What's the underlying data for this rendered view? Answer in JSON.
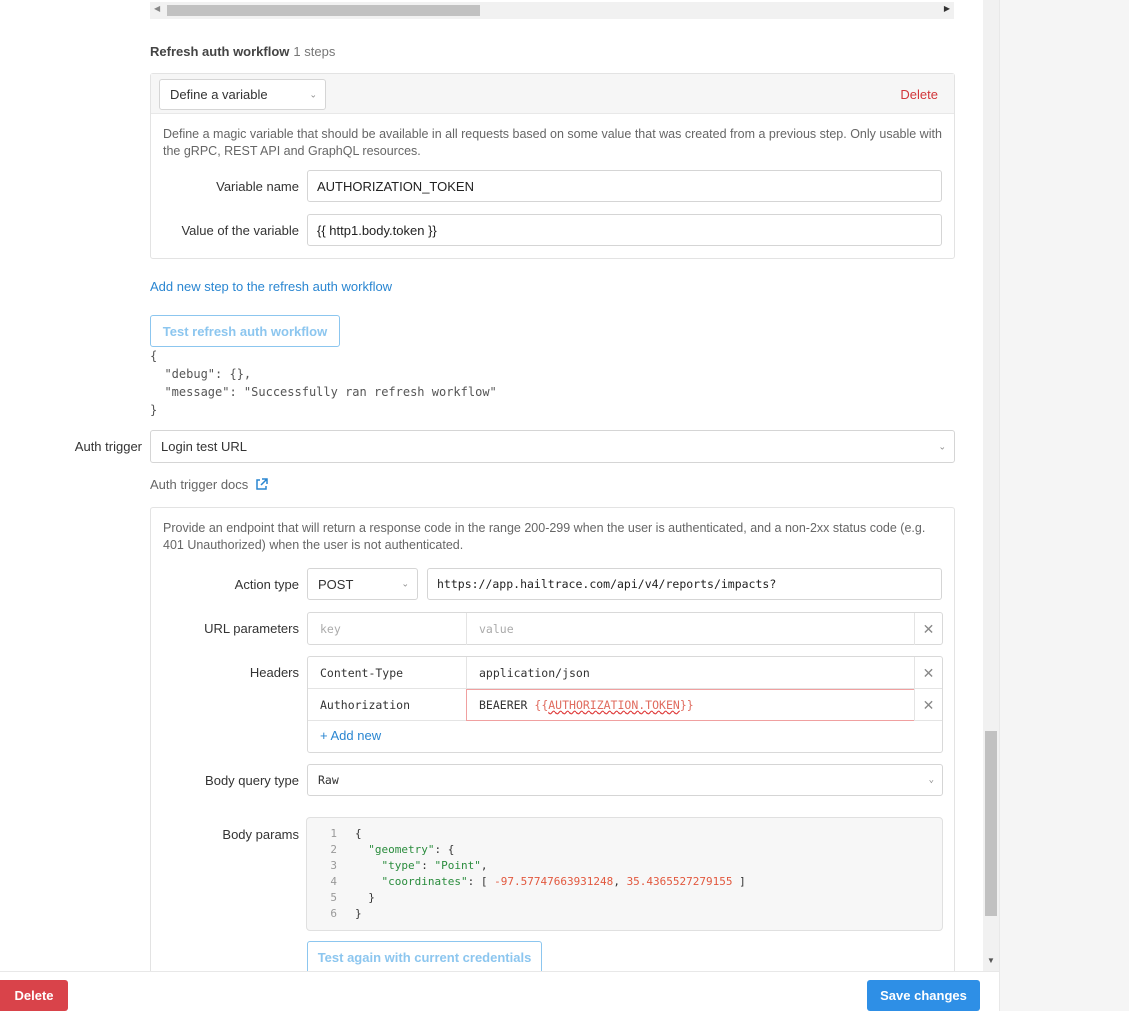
{
  "refresh": {
    "title": "Refresh auth workflow",
    "steps": "1 steps",
    "step_type": "Define a variable",
    "delete_label": "Delete",
    "description": "Define a magic variable that should be available in all requests based on some value that was created from a previous step. Only usable with the gRPC, REST API and GraphQL resources.",
    "variable_name_label": "Variable name",
    "variable_name_value": "AUTHORIZATION_TOKEN",
    "variable_value_label": "Value of the variable",
    "variable_value_value": "{{ http1.body.token }}",
    "add_step_link": "Add new step to the refresh auth workflow",
    "test_button": "Test refresh auth workflow",
    "test_output": "{\n  \"debug\": {},\n  \"message\": \"Successfully ran refresh workflow\"\n}"
  },
  "auth_trigger": {
    "label": "Auth trigger",
    "value": "Login test URL",
    "docs_link": "Auth trigger docs",
    "description": "Provide an endpoint that will return a response code in the range 200-299 when the user is authenticated, and a non-2xx status code (e.g. 401 Unauthorized) when the user is not authenticated.",
    "action_type_label": "Action type",
    "action_method": "POST",
    "action_url": "https://app.hailtrace.com/api/v4/reports/impacts?",
    "url_params_label": "URL parameters",
    "url_params_key_placeholder": "key",
    "url_params_value_placeholder": "value",
    "headers_label": "Headers",
    "headers": [
      {
        "key": "Content-Type",
        "value": "application/json"
      },
      {
        "key": "Authorization",
        "value_prefix": "BEAERER ",
        "value_template_open": "{{",
        "value_template_var": "AUTHORIZATION.TOKEN",
        "value_template_close": "}}"
      }
    ],
    "add_new": "+ Add new",
    "body_query_type_label": "Body query type",
    "body_query_type": "Raw",
    "body_params_label": "Body params",
    "body_lines": [
      "1",
      "2",
      "3",
      "4",
      "5",
      "6"
    ],
    "body_code": {
      "l1": "{",
      "l2_key": "\"geometry\"",
      "l3_key": "\"type\"",
      "l3_val": "\"Point\"",
      "l4_key": "\"coordinates\"",
      "l4_num1": "-97.57747663931248",
      "l4_num2": "35.4365527279155",
      "l5": "}",
      "l6": "}"
    },
    "test_again_button": "Test again with current credentials"
  },
  "footer": {
    "delete_label": "Delete",
    "save_label": "Save changes"
  },
  "colors": {
    "primary": "#2e8fe6",
    "danger": "#d9434a",
    "link": "#2a86d1"
  }
}
